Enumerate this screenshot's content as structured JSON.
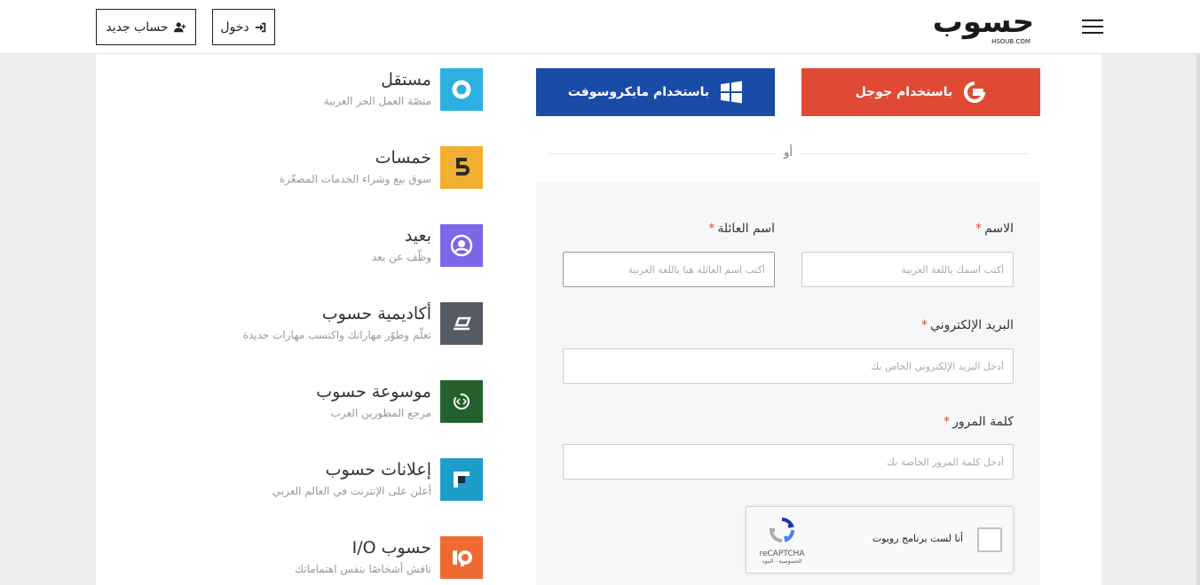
{
  "header": {
    "logo_text": "حسوب",
    "logo_sub": "HSOUB.COM",
    "login_label": "دخول",
    "signup_label": "حساب جديد"
  },
  "apps": [
    {
      "title": "مستقل",
      "subtitle": "منصّة العمل الحر العربية",
      "color": "#2bb0e0",
      "icon": "mostaql-icon"
    },
    {
      "title": "خمسات",
      "subtitle": "سوق بيع وشراء الخدمات المصغّرة",
      "color": "#f2ae2e",
      "icon": "khamsat-icon"
    },
    {
      "title": "بعيد",
      "subtitle": "وظّف عن بعد",
      "color": "#7a68e8",
      "icon": "baeed-icon"
    },
    {
      "title": "أكاديمية حسوب",
      "subtitle": "تعلّم وطوّر مهاراتك واكتسب مهارات جديدة",
      "color": "#545b63",
      "icon": "academy-icon"
    },
    {
      "title": "موسوعة حسوب",
      "subtitle": "مرجع المطورين العرب",
      "color": "#25612d",
      "icon": "wiki-icon"
    },
    {
      "title": "إعلانات حسوب",
      "subtitle": "أعلن على الإنترنت في العالم العربي",
      "color": "#1c9ec6",
      "icon": "ads-icon"
    },
    {
      "title": "حسوب I/O",
      "subtitle": "ناقش أشخاصًا بنفس اهتماماتك",
      "color": "#ef6a33",
      "icon": "io-icon"
    }
  ],
  "social": {
    "google_label": "باستخدام جوجل",
    "microsoft_label": "باستخدام مايكروسوفت",
    "google_color": "#e04a35",
    "microsoft_color": "#1a4ba6"
  },
  "or_text": "أو",
  "form": {
    "first_name_label": "الاسم",
    "first_name_placeholder": "أكتب اسمك باللغة العربية",
    "last_name_label": "اسم العائلة",
    "last_name_placeholder": "أكتب اسم العائلة هنا باللغة العربية",
    "email_label": "البريد الإلكتروني",
    "email_placeholder": "أدخل البريد الإلكتروني الخاص بك",
    "password_label": "كلمة المرور",
    "password_placeholder": "أدخل كلمة المرور الخاصة بك",
    "required_mark": "*"
  },
  "captcha": {
    "label": "أنا لست برنامج روبوت",
    "brand": "reCAPTCHA",
    "links": "الخصوصية - البنود"
  }
}
